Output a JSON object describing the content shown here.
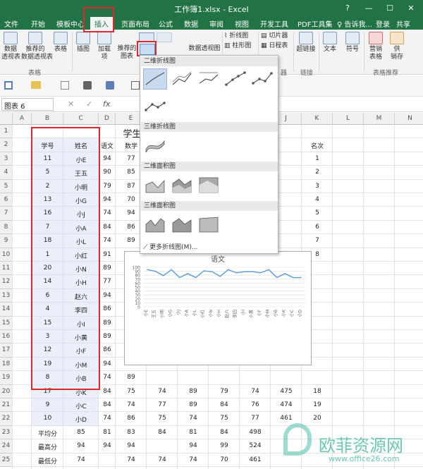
{
  "window": {
    "title": "工作簿1.xlsx - Excel",
    "controls": [
      "?",
      "—",
      "☐",
      "✕"
    ]
  },
  "tabs": [
    {
      "label": "文件"
    },
    {
      "label": "开始"
    },
    {
      "label": "模板中心"
    },
    {
      "label": "插入"
    },
    {
      "label": "页面布局"
    },
    {
      "label": "公式"
    },
    {
      "label": "数据"
    },
    {
      "label": "审阅"
    },
    {
      "label": "视图"
    },
    {
      "label": "开发工具"
    },
    {
      "label": "PDF工具集"
    },
    {
      "label": "♀ 告诉我..."
    },
    {
      "label": "登录"
    },
    {
      "label": "共享"
    }
  ],
  "ribbon": {
    "buttons": [
      {
        "label": "数据\n透视表"
      },
      {
        "label": "推荐的\n数据透视表"
      },
      {
        "label": "表格"
      },
      {
        "label": "插图"
      },
      {
        "label": "加载\n项"
      },
      {
        "label": "推荐的\n图表"
      },
      {
        "label": "数据透视图"
      },
      {
        "label": "折线图"
      },
      {
        "label": "柱形图"
      },
      {
        "label": "切片器"
      },
      {
        "label": "日程表"
      },
      {
        "label": "超链接"
      },
      {
        "label": "文本"
      },
      {
        "label": "符号"
      },
      {
        "label": "营销\n表格"
      },
      {
        "label": "供\n销存"
      }
    ],
    "groups": [
      "表格",
      "器",
      "链接",
      "表格推荐"
    ]
  },
  "namebox": "图表 6",
  "formula_icons": [
    "✕",
    "✓",
    "fx"
  ],
  "sheet": {
    "columns": [
      "A",
      "B",
      "C",
      "D",
      "E",
      "F",
      "G",
      "H",
      "I",
      "J",
      "K",
      "L",
      "M",
      "N"
    ],
    "title": "学生成",
    "headers": [
      "学号",
      "姓名",
      "语文",
      "数学",
      "英语",
      "名次"
    ],
    "rows": [
      [
        "11",
        "小E",
        "94",
        "77",
        "94",
        "",
        "",
        "",
        "",
        "1"
      ],
      [
        "5",
        "王五",
        "90",
        "85",
        "86",
        "",
        "",
        "",
        "",
        "2"
      ],
      [
        "2",
        "小明",
        "79",
        "87",
        "",
        "",
        "",
        "",
        "",
        "3"
      ],
      [
        "13",
        "小G",
        "94",
        "70",
        "88",
        "",
        "",
        "",
        "",
        "4"
      ],
      [
        "16",
        "小J",
        "74",
        "94",
        "80",
        "",
        "",
        "",
        "",
        "5"
      ],
      [
        "7",
        "小A",
        "84",
        "86",
        "88",
        "",
        "",
        "",
        "",
        "6"
      ],
      [
        "18",
        "小L",
        "74",
        "89",
        "88",
        "",
        "",
        "",
        "",
        "7"
      ],
      [
        "1",
        "小红",
        "91",
        "80",
        "",
        "",
        "",
        "",
        "",
        "8"
      ],
      [
        "20",
        "小N",
        "89",
        "74",
        "",
        "",
        "",
        "",
        "",
        ""
      ],
      [
        "14",
        "小H",
        "77",
        "73",
        "",
        "",
        "",
        "",
        "",
        ""
      ],
      [
        "6",
        "赵六",
        "94",
        "80",
        "",
        "",
        "",
        "",
        "",
        ""
      ],
      [
        "4",
        "李四",
        "86",
        "81",
        "",
        "",
        "",
        "",
        "",
        ""
      ],
      [
        "15",
        "小I",
        "89",
        "77",
        "",
        "",
        "",
        "",
        "",
        ""
      ],
      [
        "3",
        "小黄",
        "89",
        "82",
        "",
        "",
        "",
        "",
        "",
        ""
      ],
      [
        "12",
        "小F",
        "86",
        "80",
        "",
        "",
        "",
        "",
        "",
        ""
      ],
      [
        "19",
        "小M",
        "94",
        "77",
        "",
        "",
        "",
        "",
        "",
        ""
      ],
      [
        "8",
        "小B",
        "74",
        "89",
        "",
        "",
        "",
        "",
        "",
        ""
      ],
      [
        "17",
        "小K",
        "84",
        "75",
        "74",
        "89",
        "79",
        "74",
        "475",
        "18"
      ],
      [
        "9",
        "小C",
        "84",
        "74",
        "77",
        "89",
        "84",
        "76",
        "474",
        "19"
      ],
      [
        "10",
        "小D",
        "74",
        "86",
        "75",
        "74",
        "75",
        "77",
        "461",
        "20"
      ]
    ],
    "summary": [
      [
        "平均分",
        "85",
        "81",
        "83",
        "84",
        "81",
        "84",
        "498"
      ],
      [
        "最高分",
        "94",
        "94",
        "94",
        "",
        "94",
        "99",
        "524"
      ],
      [
        "最低分",
        "74",
        "",
        "74",
        "74",
        "74",
        "70",
        "461"
      ]
    ]
  },
  "dropdown": {
    "sections": [
      "二维折线图",
      "三维折线图",
      "二维面积图",
      "三维面积图"
    ],
    "more": "更多折线图(M)..."
  },
  "chart_data": {
    "type": "line",
    "title": "语文",
    "categories": [
      "小E",
      "王五",
      "小明",
      "小G",
      "小J",
      "小A",
      "小L",
      "小红",
      "小N",
      "小H",
      "赵六",
      "李四",
      "小I",
      "小黄",
      "小F",
      "小M",
      "小B",
      "小K",
      "小C",
      "小D"
    ],
    "series": [
      {
        "values": [
          94,
          90,
          79,
          94,
          74,
          84,
          74,
          91,
          89,
          77,
          94,
          86,
          89,
          89,
          86,
          94,
          74,
          84,
          74,
          74
        ]
      }
    ],
    "yticks": [
      0,
      10,
      20,
      30,
      40,
      50,
      60,
      70,
      80,
      90,
      100
    ],
    "ylim": [
      0,
      100
    ],
    "grid": true,
    "color": "#5b9bd5"
  },
  "watermark": {
    "cn": "欧菲资源网",
    "url": "www.office26.com"
  }
}
